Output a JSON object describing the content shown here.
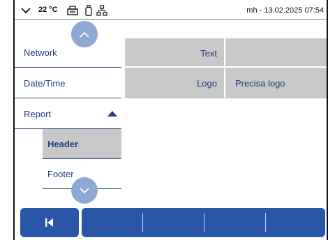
{
  "statusbar": {
    "temperature": "22 °C",
    "user_datetime": "mh - 13.02.2025 07:54",
    "icons": [
      "chevron-down-icon",
      "printer-icon",
      "bottle-icon",
      "network-icon"
    ]
  },
  "sidebar": {
    "items": [
      {
        "label": "Network"
      },
      {
        "label": "Date/Time"
      },
      {
        "label": "Report",
        "expanded": true
      },
      {
        "label": "Header",
        "selected": true
      },
      {
        "label": "Footer"
      }
    ]
  },
  "table": {
    "rows": [
      {
        "label": "Text",
        "value": ""
      },
      {
        "label": "Logo",
        "value": "Precisa logo"
      }
    ]
  },
  "bottombar": {
    "back_icon": "back-to-start-icon",
    "function_buttons": 4
  },
  "colors": {
    "accent": "#2a56a8",
    "scroll_button": "#8ea8d6",
    "text": "#1f3f7a",
    "selection": "#c8c8c8"
  }
}
